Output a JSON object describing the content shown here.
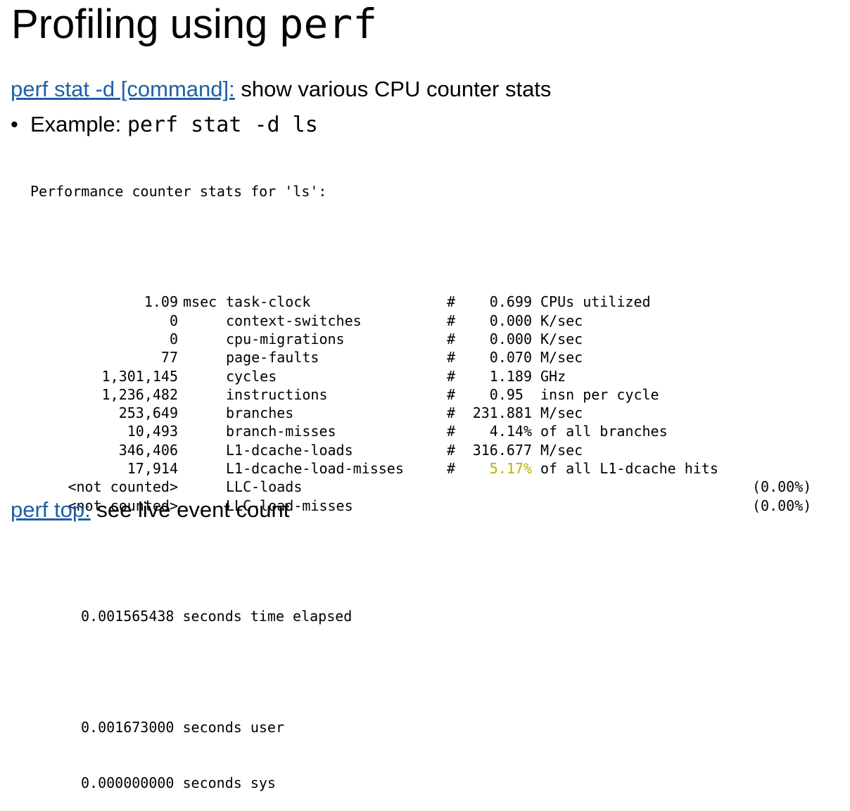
{
  "title": {
    "text": "Profiling using ",
    "code": "perf"
  },
  "line1": {
    "link": "perf stat -d [command]:",
    "text": " show various CPU counter stats"
  },
  "bullet": {
    "symbol": "•",
    "label": "Example: ",
    "code": "perf stat -d ls"
  },
  "output": {
    "header": "Performance counter stats for 'ls':",
    "rows": [
      {
        "value": "1.09",
        "unit": "msec",
        "event": "task-clock",
        "hash": "#",
        "num": "0.699",
        "desc": "CPUs utilized",
        "pct": ""
      },
      {
        "value": "0",
        "unit": "",
        "event": "context-switches",
        "hash": "#",
        "num": "0.000",
        "desc": "K/sec",
        "pct": ""
      },
      {
        "value": "0",
        "unit": "",
        "event": "cpu-migrations",
        "hash": "#",
        "num": "0.000",
        "desc": "K/sec",
        "pct": ""
      },
      {
        "value": "77",
        "unit": "",
        "event": "page-faults",
        "hash": "#",
        "num": "0.070",
        "desc": "M/sec",
        "pct": ""
      },
      {
        "value": "1,301,145",
        "unit": "",
        "event": "cycles",
        "hash": "#",
        "num": "1.189",
        "desc": "GHz",
        "pct": ""
      },
      {
        "value": "1,236,482",
        "unit": "",
        "event": "instructions",
        "hash": "#",
        "num": "0.95 ",
        "desc": "insn per cycle",
        "pct": ""
      },
      {
        "value": "253,649",
        "unit": "",
        "event": "branches",
        "hash": "#",
        "num": "231.881",
        "desc": "M/sec",
        "pct": ""
      },
      {
        "value": "10,493",
        "unit": "",
        "event": "branch-misses",
        "hash": "#",
        "num": "4.14%",
        "desc": "of all branches",
        "pct": ""
      },
      {
        "value": "346,406",
        "unit": "",
        "event": "L1-dcache-loads",
        "hash": "#",
        "num": "316.677",
        "desc": "M/sec",
        "pct": ""
      },
      {
        "value": "17,914",
        "unit": "",
        "event": "L1-dcache-load-misses",
        "hash": "#",
        "num": "5.17%",
        "desc": "of all L1-dcache hits",
        "pct": "",
        "highlight": true
      },
      {
        "value": "<not counted>",
        "unit": "",
        "event": "LLC-loads",
        "hash": "",
        "num": "",
        "desc": "",
        "pct": "(0.00%)"
      },
      {
        "value": "<not counted>",
        "unit": "",
        "event": "LLC-load-misses",
        "hash": "",
        "num": "",
        "desc": "",
        "pct": "(0.00%)"
      }
    ],
    "elapsed": "0.001565438 seconds time elapsed",
    "user": "0.001673000 seconds user",
    "sys": "0.000000000 seconds sys"
  },
  "bottom": {
    "link": "perf top:",
    "text": " see live event count"
  },
  "colors": {
    "link": "#1f5fa6",
    "highlight": "#b9b300"
  }
}
